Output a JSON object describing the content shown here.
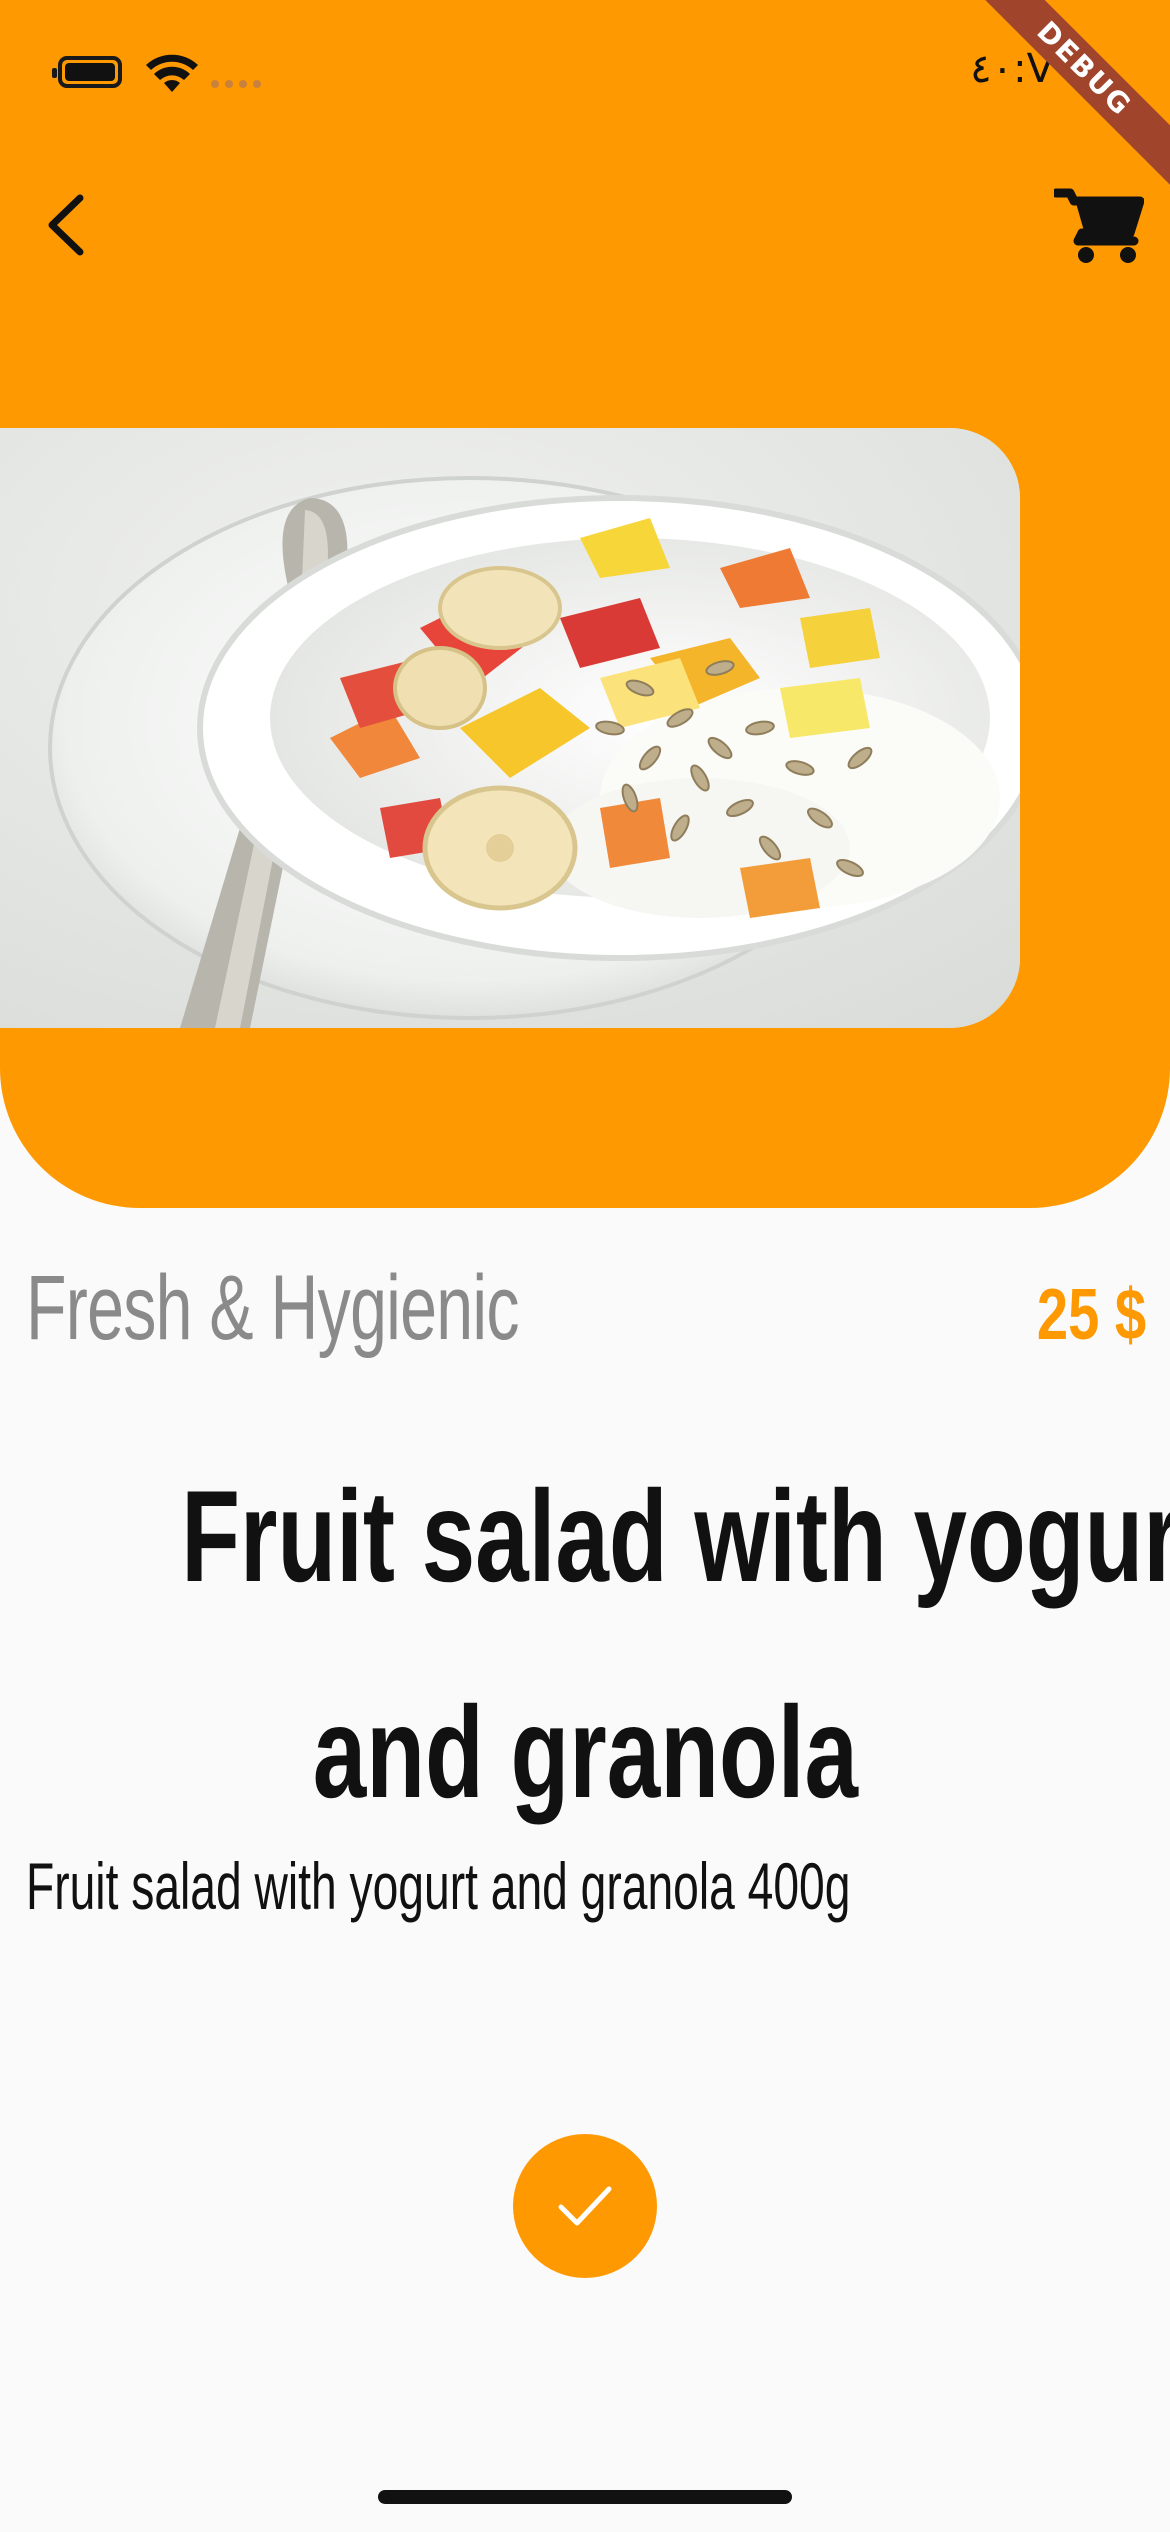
{
  "status_bar": {
    "time": "V:٤٠",
    "icons": [
      "battery-icon",
      "wifi-icon",
      "signal-icon"
    ]
  },
  "debug_banner": "DEBUG",
  "nav": {
    "back_icon": "chevron-left-icon",
    "cart_icon": "cart-icon"
  },
  "product": {
    "image_alt": "Bowl of fruit salad with yogurt and sunflower seeds",
    "tagline": "Fresh & Hygienic",
    "price": "25 $",
    "title_line1": "Fruit salad with yogurt",
    "title_line2": "and granola",
    "description": "Fruit salad with yogurt and granola 400g"
  },
  "actions": {
    "confirm_icon": "check-icon"
  },
  "colors": {
    "accent": "#fe9902",
    "background": "#fafafa",
    "text": "#111111",
    "muted_text": "#8a8a8a"
  }
}
